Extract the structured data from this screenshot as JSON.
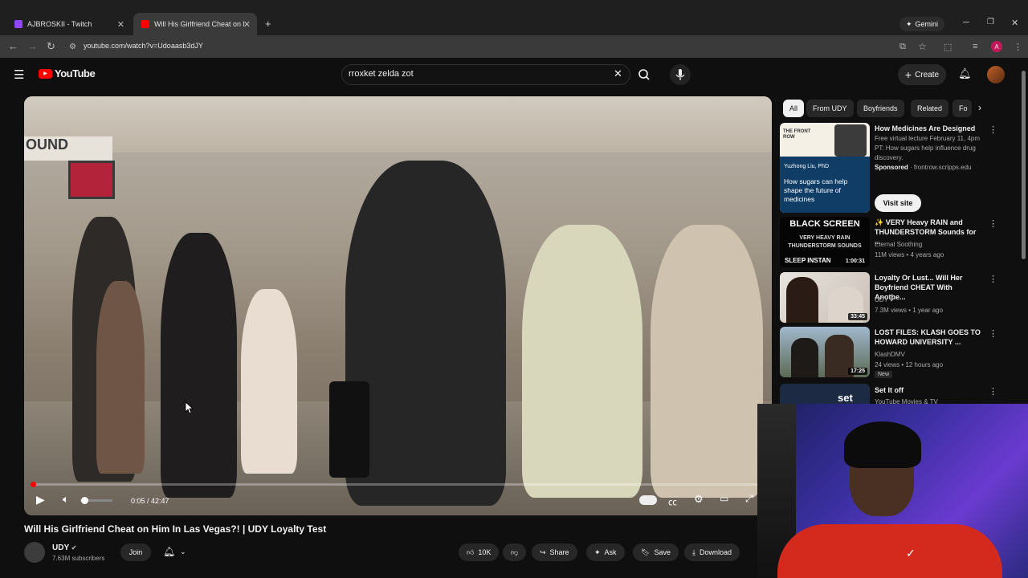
{
  "browser": {
    "tabs": [
      {
        "label": "AJBROSKII - Twitch",
        "active": false,
        "favicon_color": "#9146ff"
      },
      {
        "label": "Will His Girlfriend Cheat on Hi",
        "active": true,
        "favicon_color": "#ff0000"
      }
    ],
    "url": "youtube.com/watch?v=Udoaasb3dJY",
    "gemini_label": "Gemini",
    "profile_initial": "A"
  },
  "header": {
    "logo_text": "YouTube",
    "search_value": "rroxket zelda zot",
    "create_label": "Create"
  },
  "player": {
    "time": "0:05 / 42:47",
    "sign_text": "OUND",
    "progress_fraction": 0.002
  },
  "video": {
    "title": "Will His Girlfriend Cheat on Him In Las Vegas?! | UDY Loyalty Test",
    "channel": "UDY",
    "subscribers": "7.63M subscribers",
    "join_label": "Join",
    "likes": "10K",
    "share_label": "Share",
    "ask_label": "Ask",
    "save_label": "Save",
    "download_label": "Download"
  },
  "chips": [
    "All",
    "From UDY",
    "Boyfriends",
    "Related",
    "Fo"
  ],
  "recommendations": [
    {
      "title": "How Medicines Are Designed",
      "meta1": "Free virtual lecture February 11, 4pm PT: How sugars help influence drug discovery.",
      "sponsored": "Sponsored",
      "domain": "frontrow.scripps.edu",
      "cta": "Visit site",
      "thumb_brand": "THE FRONT ROW",
      "thumb_name": "Yuzhong Liu, PhD",
      "thumb_caption": "How sugars can help shape the future of medicines"
    },
    {
      "title": "✨ VERY Heavy RAIN and THUNDERSTORM Sounds for ...",
      "meta1": "Eternal Soothing",
      "meta2": "11M views • 4 years ago",
      "duration": "1:00:31",
      "thumb_line1": "BLACK SCREEN",
      "thumb_line2": "VERY HEAVY RAIN THUNDERSTORM SOUNDS",
      "thumb_line3": "SLEEP INSTAN"
    },
    {
      "title": "Loyalty Or Lust... Will Her Boyfriend CHEAT With Anothe...",
      "meta1": "UDY",
      "meta2": "7.3M views • 1 year ago",
      "duration": "33:45"
    },
    {
      "title": "LOST FILES: KLASH GOES TO HOWARD UNIVERSITY ...",
      "meta1": "KlashDMV",
      "meta2": "24 views • 12 hours ago",
      "badge": "New",
      "duration": "17:25"
    },
    {
      "title": "Set It off",
      "meta1": "YouTube Movies & TV",
      "thumb_text": "set"
    }
  ]
}
